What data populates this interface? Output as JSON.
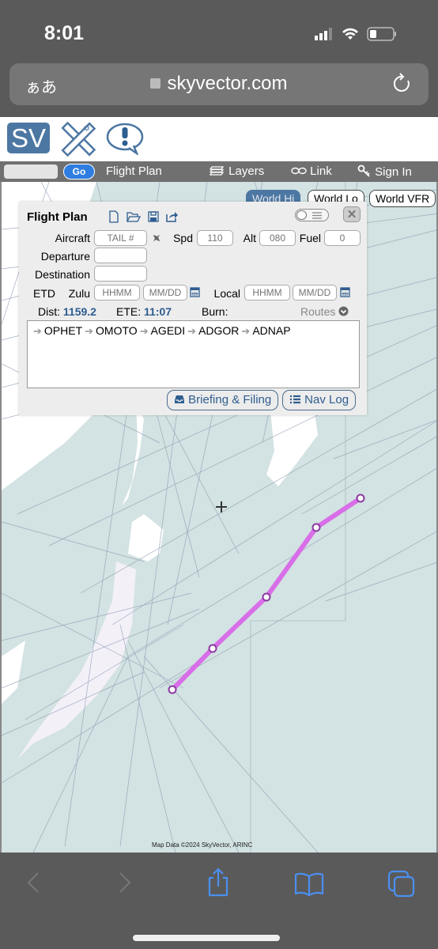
{
  "status_bar": {
    "time": "8:01",
    "icons": [
      "signal-icon",
      "wifi-icon",
      "battery-icon"
    ]
  },
  "browser": {
    "text_size_label": "ぁあ",
    "url": "skyvector.com"
  },
  "site_header": {
    "logo_text": "SV"
  },
  "toolbar": {
    "search_value": "",
    "go_label": "Go",
    "flight_plan_label": "Flight Plan",
    "layers_label": "Layers",
    "link_label": "Link",
    "sign_in_label": "Sign In"
  },
  "chart_buttons": [
    {
      "label": "World Hi",
      "active": true
    },
    {
      "label": "World Lo",
      "active": false
    },
    {
      "label": "World VFR",
      "active": false
    }
  ],
  "flight_plan": {
    "title": "Flight Plan",
    "aircraft_label": "Aircraft",
    "aircraft_placeholder": "TAIL #",
    "spd_label": "Spd",
    "spd_placeholder": "110",
    "alt_label": "Alt",
    "alt_placeholder": "080",
    "fuel_label": "Fuel",
    "fuel_placeholder": "0",
    "departure_label": "Departure",
    "departure_value": "",
    "destination_label": "Destination",
    "destination_value": "",
    "etd_label": "ETD",
    "zulu_label": "Zulu",
    "zulu_time_placeholder": "HHMM",
    "zulu_date_placeholder": "MM/DD",
    "local_label": "Local",
    "local_time_placeholder": "HHMM",
    "local_date_placeholder": "MM/DD",
    "dist_label": "Dist:",
    "dist_value": "1159.2",
    "ete_label": "ETE:",
    "ete_value": "11:07",
    "burn_label": "Burn:",
    "burn_value": "",
    "routes_label": "Routes",
    "route": [
      "OPHET",
      "OMOTO",
      "AGEDI",
      "ADGOR",
      "ADNAP"
    ],
    "briefing_label": "Briefing & Filing",
    "navlog_label": "Nav Log"
  },
  "map": {
    "attribution": "Map Data ©2024 SkyVector, ARINC",
    "route_color": "#d86ee8"
  },
  "bottom_toolbar": {
    "icons": [
      "back-icon",
      "forward-icon",
      "share-icon",
      "bookmarks-icon",
      "tabs-icon"
    ]
  }
}
